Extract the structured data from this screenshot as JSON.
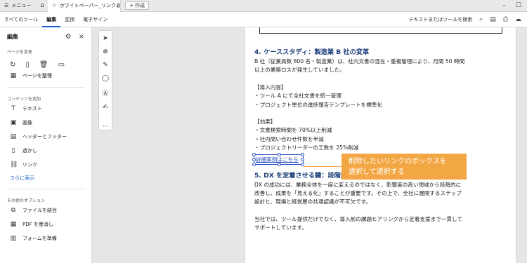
{
  "tabbar": {
    "menu_label": "メニュー",
    "tab_title": "ホワイトペーパー_リンクあ...",
    "new_label": "作成"
  },
  "toolbar": {
    "tabs": [
      "すべてのツール",
      "編集",
      "変換",
      "電子サイン"
    ],
    "search_label": "テキストまたはツールを検索"
  },
  "leftpanel": {
    "title": "編集",
    "page_section": "ページを変更",
    "crop_label": "ページを整理",
    "content_section": "コンテンツを追加",
    "add_items": [
      "テキスト",
      "画像",
      "ヘッダーとフッター",
      "透かし",
      "リンク"
    ],
    "more_label": "さらに表示",
    "other_section": "その他のオプション",
    "other_items": [
      "ファイルを結合",
      "PDF を墨消し",
      "フォームを準備"
    ]
  },
  "document": {
    "h4": "4. ケーススタディ：製造業 B 社の変革",
    "p4": [
      "B 社（従業員数 800 名・製造業）は、社内文書の混在・重複管理により、月間 50 時間",
      "以上の業務ロスが発生していました。"
    ],
    "intro_head": "【導入内容】",
    "intro_items": [
      "・ツール A にて全社文書を統一管理",
      "・プロジェクト単位の進捗報告テンプレートを標準化"
    ],
    "effect_head": "【効果】",
    "effect_items": [
      "・文書検索時間を 70%以上削減",
      "・社内問い合わせ件数を半減",
      "・プロジェクトリーダーの工数を 25%削減"
    ],
    "link_text": "詳細事例はこちら",
    "h5": "5. DX を定着させる鍵：段階的導入と社内浸透",
    "p5": [
      "DX の成功には、業務全体を一度に変えるのではなく、影響度の高い領域から段階的に",
      "改善し、成果を「見える化」することが重要です。その上で、全社に展開するステップ",
      "設計と、現場と経営層の共通認識が不可欠です。"
    ],
    "p6": [
      "当社では、ツール提供だけでなく、導入前の課題ヒアリングから定着支援まで一貫して",
      "サポートしています。"
    ]
  },
  "callout": {
    "lines": [
      "削除したいリンクのボックスを",
      "選択して選択する"
    ]
  }
}
